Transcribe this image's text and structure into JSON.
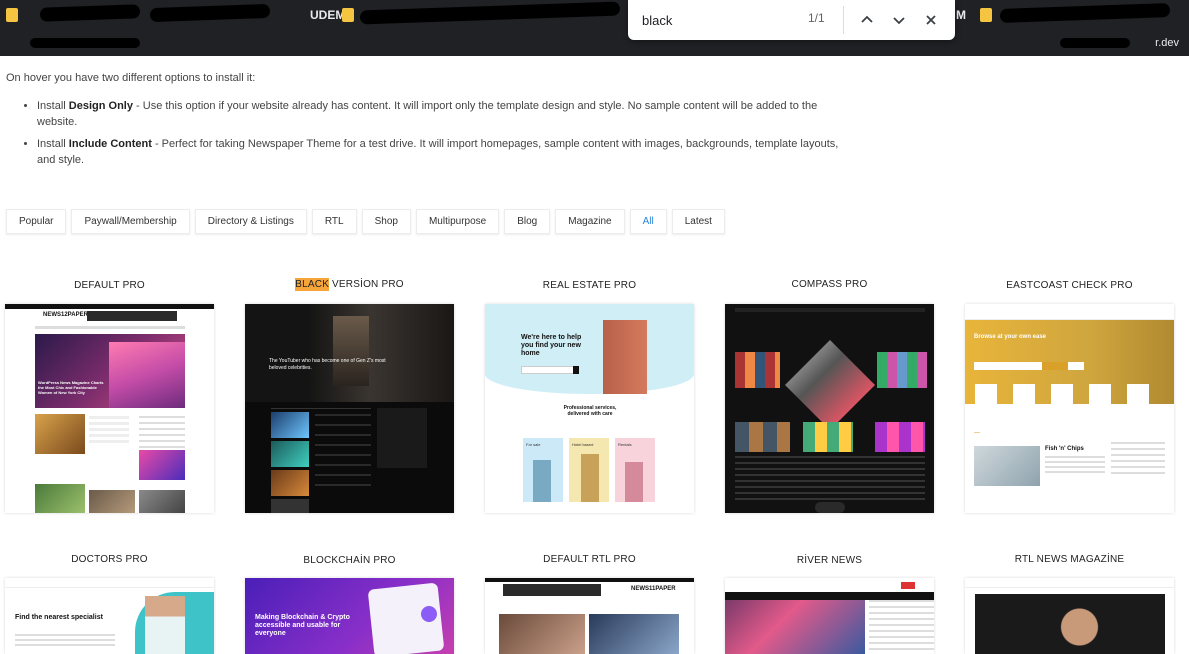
{
  "find": {
    "query": "black",
    "count": "1/1"
  },
  "bookmarks": {
    "item1": "UDEMY",
    "item2": "M"
  },
  "profile": "r.dev",
  "content": {
    "intro": "On hover you have two different options to install it:",
    "bullet1_prefix": "Install ",
    "bullet1_bold": "Design Only",
    "bullet1_text": " - Use this option if your website already has content. It will import only the template design and style. No sample content will be added to the website.",
    "bullet2_prefix": "Install ",
    "bullet2_bold": "Include Content",
    "bullet2_text": " - Perfect for taking Newspaper Theme for a test drive. It will import homepages, sample content with images, backgrounds, template layouts, and style."
  },
  "filters": [
    "Popular",
    "Paywall/Membership",
    "Directory & Listings",
    "RTL",
    "Shop",
    "Multipurpose",
    "Blog",
    "Magazine",
    "All",
    "Latest"
  ],
  "cards_row1": {
    "c1": "DEFAULT PRO",
    "c2_highlight": "BLACK",
    "c2_rest": " VERSİON PRO",
    "c3": "REAL ESTATE PRO",
    "c4": "COMPASS PRO",
    "c5": "EASTCOAST CHECK PRO"
  },
  "cards_row2": {
    "c1": "DOCTORS PRO",
    "c2": "BLOCKCHAİN PRO",
    "c3": "DEFAULT RTL PRO",
    "c4": "RİVER NEWS",
    "c5": "RTL NEWS MAGAZİNE"
  },
  "thumbs": {
    "default_logo": "NEWS12PAPER",
    "default_headline": "WordPress News Magazine Charts the Most Chic and Fashionable Women of New York City",
    "black_headline": "The YouTuber who has become one of Gen Z's most beloved celebrities.",
    "realestate_headline": "We're here to help you find your new home",
    "realestate_sub": "Professional services, delivered with care",
    "realestate_tags": [
      "For sale",
      "Hotel based",
      "Rentals"
    ],
    "eastcoast_headline": "Browse at your own ease",
    "eastcoast_item": "Fish 'n' Chips",
    "doctors_headline": "Find the nearest specialist",
    "blockchain_headline": "Making Blockchain & Crypto accessible and usable for everyone",
    "rtl_logo": "NEWS11PAPER"
  },
  "colors": {
    "chrome": "#202124",
    "highlight": "#f5a53a",
    "active_filter": "#2b86d6"
  }
}
